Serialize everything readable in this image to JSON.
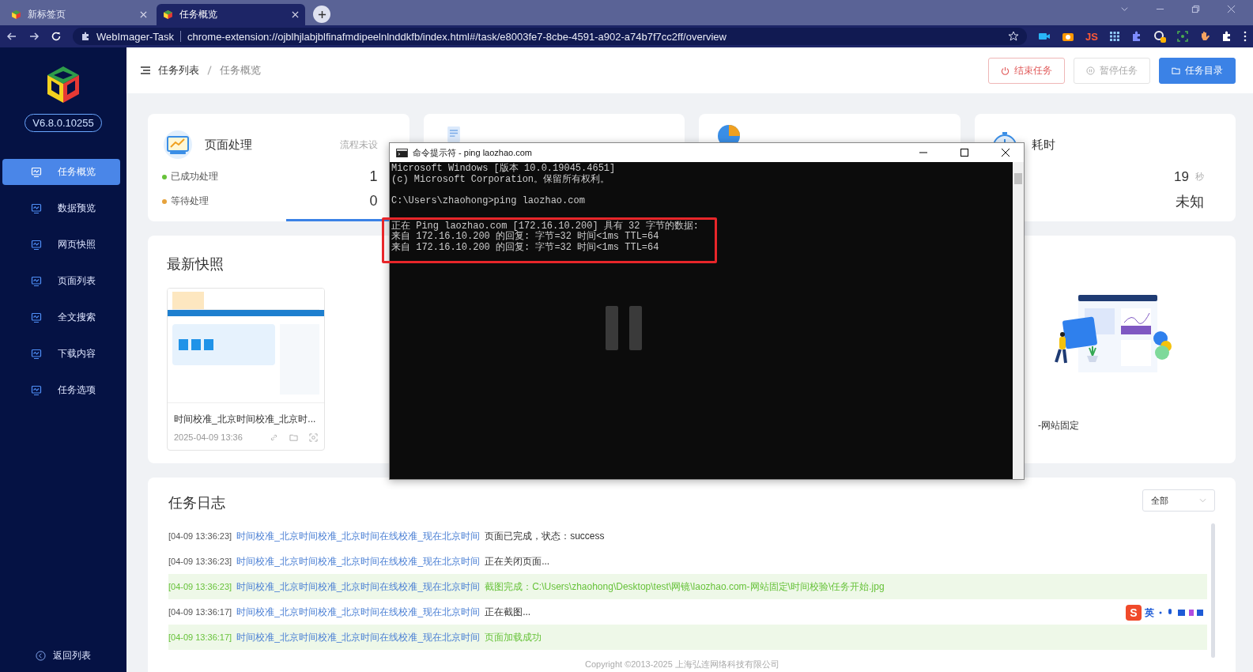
{
  "browser": {
    "tabs": [
      {
        "title": "新标签页",
        "selected": false
      },
      {
        "title": "任务概览",
        "selected": true
      }
    ],
    "address": {
      "site": "WebImager-Task",
      "url": "chrome-extension://ojblhjlabjblfinafmdipeelnlnddkfb/index.html#/task/e8003fe7-8cbe-4591-a902-a74b7f7cc2ff/overview"
    },
    "extension_label": "JS"
  },
  "sidebar": {
    "version": "V6.8.0.10255",
    "items": [
      {
        "label": "任务概览",
        "selected": true
      },
      {
        "label": "数据预览",
        "selected": false
      },
      {
        "label": "网页快照",
        "selected": false
      },
      {
        "label": "页面列表",
        "selected": false
      },
      {
        "label": "全文搜索",
        "selected": false
      },
      {
        "label": "下载内容",
        "selected": false
      },
      {
        "label": "任务选项",
        "selected": false
      }
    ],
    "back_label": "返回列表"
  },
  "header": {
    "breadcrumb": [
      "任务列表",
      "任务概览"
    ],
    "buttons": [
      {
        "label": "结束任务",
        "kind": "danger"
      },
      {
        "label": "暂停任务",
        "kind": "disabled"
      },
      {
        "label": "任务目录",
        "kind": "primary"
      }
    ]
  },
  "cards": [
    {
      "kind": "stats",
      "title": "页面处理",
      "hint": "流程未设",
      "items": [
        {
          "label": "已成功处理",
          "value": "1",
          "color": "#67c23a"
        },
        {
          "label": "等待处理",
          "value": "0",
          "color": "#e6a23c"
        }
      ]
    },
    {
      "kind": "covered"
    },
    {
      "kind": "covered"
    },
    {
      "kind": "stats",
      "title": "耗时",
      "items": [
        {
          "value": "19",
          "unit": "秒"
        },
        {
          "value": "未知"
        }
      ]
    }
  ],
  "snapshot": {
    "title": "最新快照",
    "items": [
      {
        "caption": "时间校准_北京时间校准_北京时...",
        "date": "2025-04-09 13:36"
      }
    ],
    "fragment": "-网站固定"
  },
  "log": {
    "title": "任务日志",
    "filter": "全部",
    "entries": [
      {
        "time": "[04-09 13:36:23]",
        "task": "时间校准_北京时间校准_北京时间在线校准_现在北京时间",
        "message": "页面已完成，状态：success",
        "kind": "info"
      },
      {
        "time": "[04-09 13:36:23]",
        "task": "时间校准_北京时间校准_北京时间在线校准_现在北京时间",
        "message": "正在关闭页面...",
        "kind": "info"
      },
      {
        "time": "[04-09 13:36:23]",
        "task": "时间校准_北京时间校准_北京时间在线校准_现在北京时间",
        "message": "截图完成：C:\\Users\\zhaohong\\Desktop\\test\\网镜\\laozhao.com-网站固定\\时间校验\\任务开始.jpg",
        "kind": "success"
      },
      {
        "time": "[04-09 13:36:17]",
        "task": "时间校准_北京时间校准_北京时间在线校准_现在北京时间",
        "message": "正在截图...",
        "kind": "info"
      },
      {
        "time": "[04-09 13:36:17]",
        "task": "时间校准_北京时间校准_北京时间在线校准_现在北京时间",
        "message": "页面加载成功",
        "kind": "success"
      }
    ],
    "footer": "Copyright ©2013-2025 上海弘连网络科技有限公司"
  },
  "cmd": {
    "title": "命令提示符 - ping  laozhao.com",
    "lines": [
      {
        "text": "Microsoft Windows [版本 10.0.19045.4651]",
        "highlighted": false
      },
      {
        "text": "(c) Microsoft Corporation。保留所有权利。",
        "highlighted": false
      },
      {
        "text": "C:\\Users\\zhaohong>ping laozhao.com",
        "highlighted": false
      },
      {
        "text": "正在 Ping laozhao.com [172.16.10.200] 具有 32 字节的数据:",
        "highlighted": true
      },
      {
        "text": "来自 172.16.10.200 的回复: 字节=32 时间<1ms TTL=64",
        "highlighted": true
      },
      {
        "text": "来自 172.16.10.200 的回复: 字节=32 时间<1ms TTL=64",
        "highlighted": true
      }
    ]
  },
  "ime": {
    "logo": "S",
    "label": "英"
  }
}
